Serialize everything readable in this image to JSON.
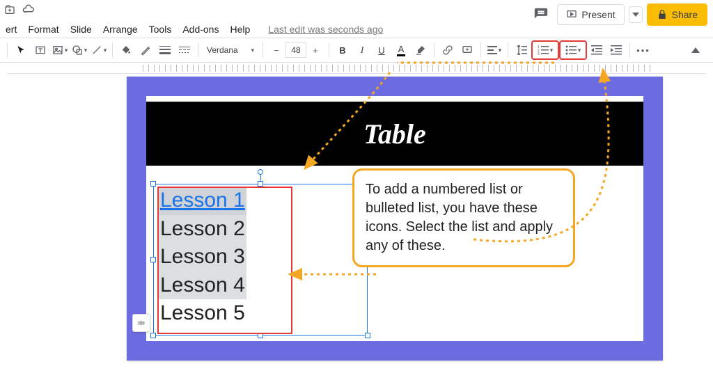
{
  "header": {
    "comments_icon": "comment",
    "present_label": "Present",
    "share_label": "Share"
  },
  "menu": {
    "insert": "ert",
    "format": "Format",
    "slide": "Slide",
    "arrange": "Arrange",
    "tools": "Tools",
    "addons": "Add-ons",
    "help": "Help",
    "last_edit": "Last edit was seconds ago"
  },
  "toolbar": {
    "font_name": "Verdana",
    "font_size": "48",
    "bold": "B",
    "italic": "I",
    "underline": "U",
    "text_color": "A",
    "more": "•••"
  },
  "slide": {
    "title": "Table",
    "lessons": [
      "Lesson 1",
      "Lesson 2",
      "Lesson 3",
      "Lesson 4",
      "Lesson 5"
    ]
  },
  "callout": {
    "text": "To add a numbered list or bulleted list, you have these icons. Select the list and apply any of these."
  }
}
